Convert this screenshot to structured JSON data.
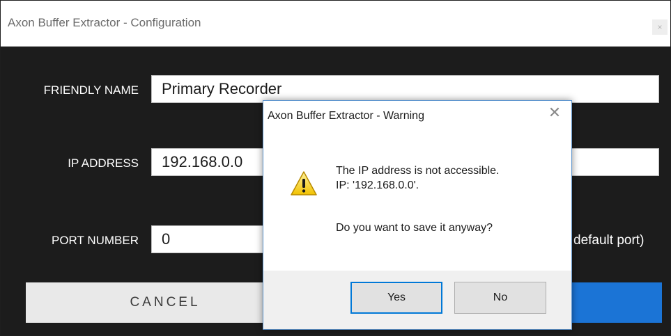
{
  "window": {
    "title": "Axon Buffer Extractor - Configuration",
    "close_glyph": "×"
  },
  "form": {
    "friendly_name_label": "FRIENDLY NAME",
    "friendly_name_value": "Primary Recorder",
    "ip_address_label": "IP ADDRESS",
    "ip_address_value": "192.168.0.0",
    "port_number_label": "PORT NUMBER",
    "port_number_value": "0",
    "port_hint": "default port)"
  },
  "buttons": {
    "cancel_label": "CANCEL"
  },
  "dialog": {
    "title": "Axon Buffer Extractor - Warning",
    "close_glyph": "✕",
    "message_line1": "The IP address is not accessible.",
    "message_line2": "IP: '192.168.0.0'.",
    "question": "Do you want to save it anyway?",
    "yes_label": "Yes",
    "no_label": "No",
    "icon": "warning-icon"
  },
  "colors": {
    "background": "#1c1c1c",
    "accent": "#1b74d6",
    "dialog_border": "#5e95cf",
    "default_button_border": "#0078d7"
  }
}
